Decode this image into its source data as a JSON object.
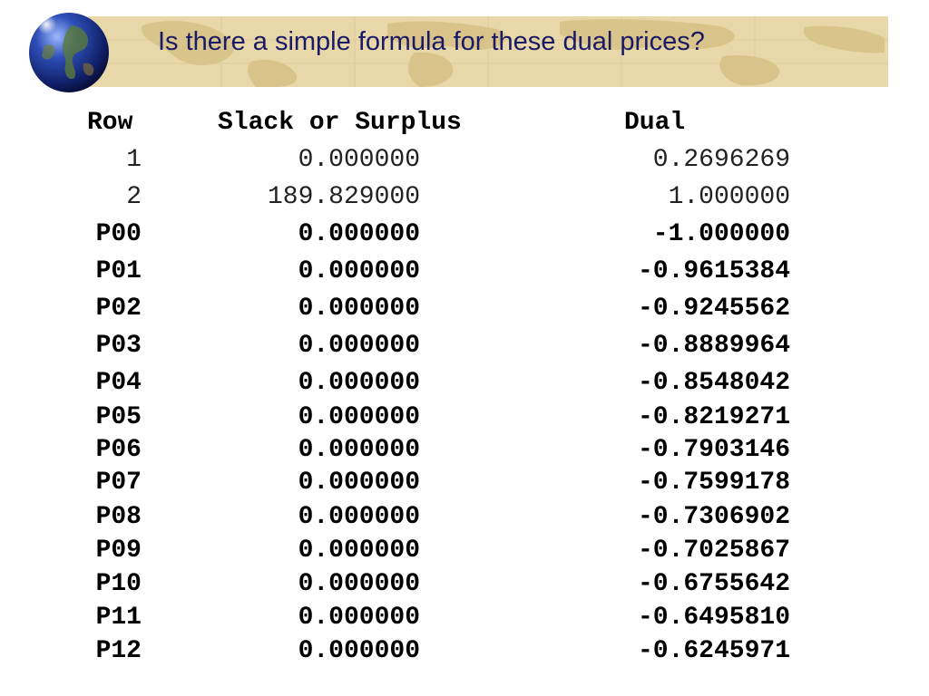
{
  "title": "Is there a simple formula for these dual prices?",
  "headers": {
    "row": "Row",
    "slack": "Slack or Surplus",
    "dual": "Dual"
  },
  "rows": [
    {
      "row": "1",
      "slack": "0.000000",
      "dual": "0.2696269"
    },
    {
      "row": "2",
      "slack": "189.829000",
      "dual": "1.000000"
    },
    {
      "row": "P00",
      "slack": "0.000000",
      "dual": "-1.000000"
    },
    {
      "row": "P01",
      "slack": "0.000000",
      "dual": "-0.9615384"
    },
    {
      "row": "P02",
      "slack": "0.000000",
      "dual": "-0.9245562"
    },
    {
      "row": "P03",
      "slack": "0.000000",
      "dual": "-0.8889964"
    },
    {
      "row": "P04",
      "slack": "0.000000",
      "dual": "-0.8548042"
    },
    {
      "row": "P05",
      "slack": "0.000000",
      "dual": "-0.8219271"
    },
    {
      "row": "P06",
      "slack": "0.000000",
      "dual": "-0.7903146"
    },
    {
      "row": "P07",
      "slack": "0.000000",
      "dual": "-0.7599178"
    },
    {
      "row": "P08",
      "slack": "0.000000",
      "dual": "-0.7306902"
    },
    {
      "row": "P09",
      "slack": "0.000000",
      "dual": "-0.7025867"
    },
    {
      "row": "P10",
      "slack": "0.000000",
      "dual": "-0.6755642"
    },
    {
      "row": "P11",
      "slack": "0.000000",
      "dual": "-0.6495810"
    },
    {
      "row": "P12",
      "slack": "0.000000",
      "dual": "-0.6245971"
    }
  ]
}
